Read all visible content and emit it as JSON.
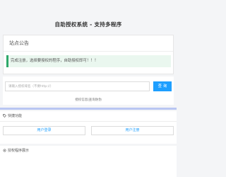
{
  "site": {
    "title": "自助授权系统 - 支持多程序"
  },
  "notice": {
    "title": "站点公告",
    "message": "完成注册，选择要授权的程序，自助授权即可！！！"
  },
  "query": {
    "placeholder": "请输入授权域名（不要http://）",
    "button_label": "查 询",
    "link_text": "授权信息|查询防伪"
  },
  "quick_functions": {
    "icon": "tag-icon",
    "title": "快捷功能",
    "buttons": [
      {
        "label": "用户登录"
      },
      {
        "label": "用户注册"
      }
    ]
  },
  "showcase": {
    "icon": "gear-icon",
    "title": "授权程序展示"
  },
  "colors": {
    "accent": "#1e9fff",
    "alert_border": "#2ea86a",
    "alert_bg": "#eaf7ef",
    "divider": "#b9c6f2"
  }
}
